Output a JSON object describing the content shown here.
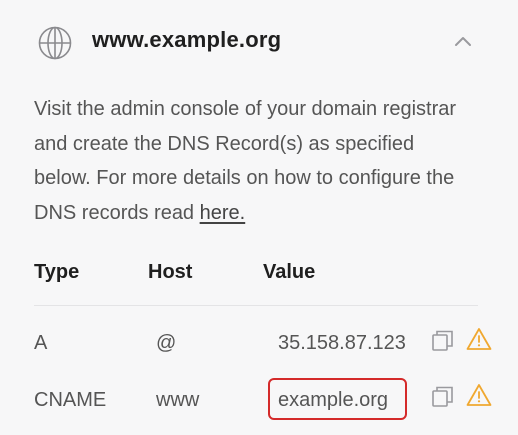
{
  "header": {
    "domain": "www.example.org",
    "icon": "globe-icon",
    "collapse_icon": "chevron-up-icon"
  },
  "description": {
    "text": "Visit the admin console of your domain registrar and create the DNS Record(s) as specified below. For more details on how to configure the DNS records read ",
    "link_label": "here."
  },
  "table": {
    "columns": [
      "Type",
      "Host",
      "Value"
    ],
    "rows": [
      {
        "type": "A",
        "host": "@",
        "value": "35.158.87.123"
      },
      {
        "type": "CNAME",
        "host": "www",
        "value": "example.org"
      }
    ]
  },
  "colors": {
    "warning": "#f0a830",
    "highlight": "#d42a2a"
  }
}
